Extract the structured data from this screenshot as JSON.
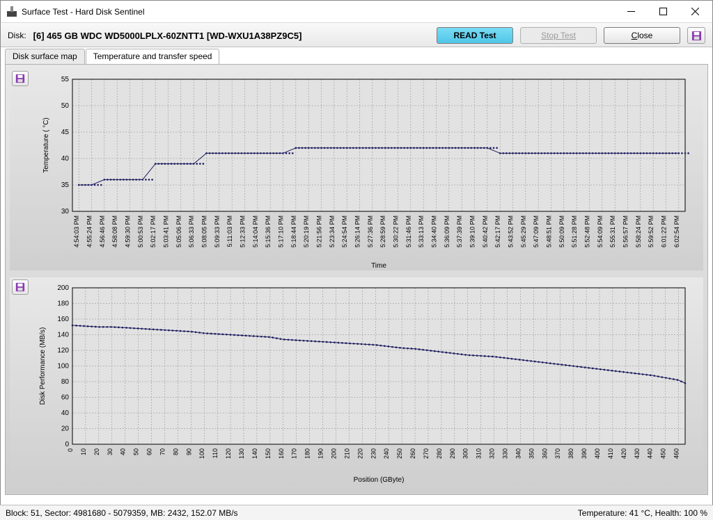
{
  "window": {
    "title": "Surface Test - Hard Disk Sentinel"
  },
  "toolbar": {
    "disk_label": "Disk:",
    "disk_info": "[6] 465 GB  WDC WD5000LPLX-60ZNTT1 [WD-WXU1A38PZ9C5]",
    "read_test": "READ Test",
    "stop_test": "Stop Test",
    "close_text": "lose",
    "close_prefix": "C"
  },
  "tabs": {
    "surface": "Disk surface map",
    "temp_speed": "Temperature and transfer speed"
  },
  "status": {
    "left": "Block: 51, Sector: 4981680 - 5079359, MB: 2432, 152.07 MB/s",
    "right": "Temperature: 41  °C,  Health: 100 %"
  },
  "chart_data": [
    {
      "type": "line",
      "title": "",
      "xlabel": "Time",
      "ylabel": "Temperature ( °C)",
      "ylim": [
        30,
        55
      ],
      "yticks": [
        30,
        35,
        40,
        45,
        50,
        55
      ],
      "x": [
        "4:54:03 PM",
        "4:55:24 PM",
        "4:56:46 PM",
        "4:58:08 PM",
        "4:59:30 PM",
        "5:00:53 PM",
        "5:02:17 PM",
        "5:03:41 PM",
        "5:05:06 PM",
        "5:06:33 PM",
        "5:08:05 PM",
        "5:09:33 PM",
        "5:11:03 PM",
        "5:12:33 PM",
        "5:14:04 PM",
        "5:15:36 PM",
        "5:17:10 PM",
        "5:18:44 PM",
        "5:20:19 PM",
        "5:21:56 PM",
        "5:23:34 PM",
        "5:24:54 PM",
        "5:26:14 PM",
        "5:27:36 PM",
        "5:28:59 PM",
        "5:30:22 PM",
        "5:31:46 PM",
        "5:33:13 PM",
        "5:34:40 PM",
        "5:36:09 PM",
        "5:37:39 PM",
        "5:39:10 PM",
        "5:40:42 PM",
        "5:42:17 PM",
        "5:43:52 PM",
        "5:45:29 PM",
        "5:47:09 PM",
        "5:48:51 PM",
        "5:50:09 PM",
        "5:51:28 PM",
        "5:52:48 PM",
        "5:54:09 PM",
        "5:55:31 PM",
        "5:56:57 PM",
        "5:58:24 PM",
        "5:59:52 PM",
        "6:01:22 PM",
        "6:02:54 PM"
      ],
      "values": [
        35,
        35,
        36,
        36,
        36,
        36,
        39,
        39,
        39,
        39,
        41,
        41,
        41,
        41,
        41,
        41,
        41,
        42,
        42,
        42,
        42,
        42,
        42,
        42,
        42,
        42,
        42,
        42,
        42,
        42,
        42,
        42,
        42,
        41,
        41,
        41,
        41,
        41,
        41,
        41,
        41,
        41,
        41,
        41,
        41,
        41,
        41,
        41
      ]
    },
    {
      "type": "line",
      "title": "",
      "xlabel": "Position (GByte)",
      "ylabel": "Disk Performance (MB/s)",
      "ylim": [
        0,
        200
      ],
      "yticks": [
        0,
        20,
        40,
        60,
        80,
        100,
        120,
        140,
        160,
        180,
        200
      ],
      "xticks": [
        0,
        10,
        20,
        30,
        40,
        50,
        60,
        70,
        80,
        90,
        100,
        110,
        120,
        130,
        140,
        150,
        160,
        170,
        180,
        190,
        200,
        210,
        220,
        230,
        240,
        250,
        260,
        270,
        280,
        290,
        300,
        310,
        320,
        330,
        340,
        350,
        360,
        370,
        380,
        390,
        400,
        410,
        420,
        430,
        440,
        450,
        460
      ],
      "series": [
        {
          "name": "performance",
          "x": [
            0,
            10,
            20,
            30,
            40,
            50,
            60,
            70,
            80,
            90,
            100,
            110,
            120,
            130,
            140,
            150,
            160,
            170,
            180,
            190,
            200,
            210,
            220,
            230,
            240,
            250,
            260,
            270,
            280,
            290,
            300,
            310,
            320,
            330,
            340,
            350,
            360,
            370,
            380,
            390,
            400,
            410,
            420,
            430,
            440,
            450,
            460,
            465
          ],
          "values": [
            152,
            151,
            150,
            150,
            149,
            148,
            147,
            146,
            145,
            144,
            142,
            141,
            140,
            139,
            138,
            137,
            134,
            133,
            132,
            131,
            130,
            129,
            128,
            127,
            125,
            123,
            122,
            120,
            118,
            116,
            114,
            113,
            112,
            110,
            108,
            106,
            104,
            102,
            100,
            98,
            96,
            94,
            92,
            90,
            88,
            85,
            82,
            78
          ]
        }
      ]
    }
  ]
}
